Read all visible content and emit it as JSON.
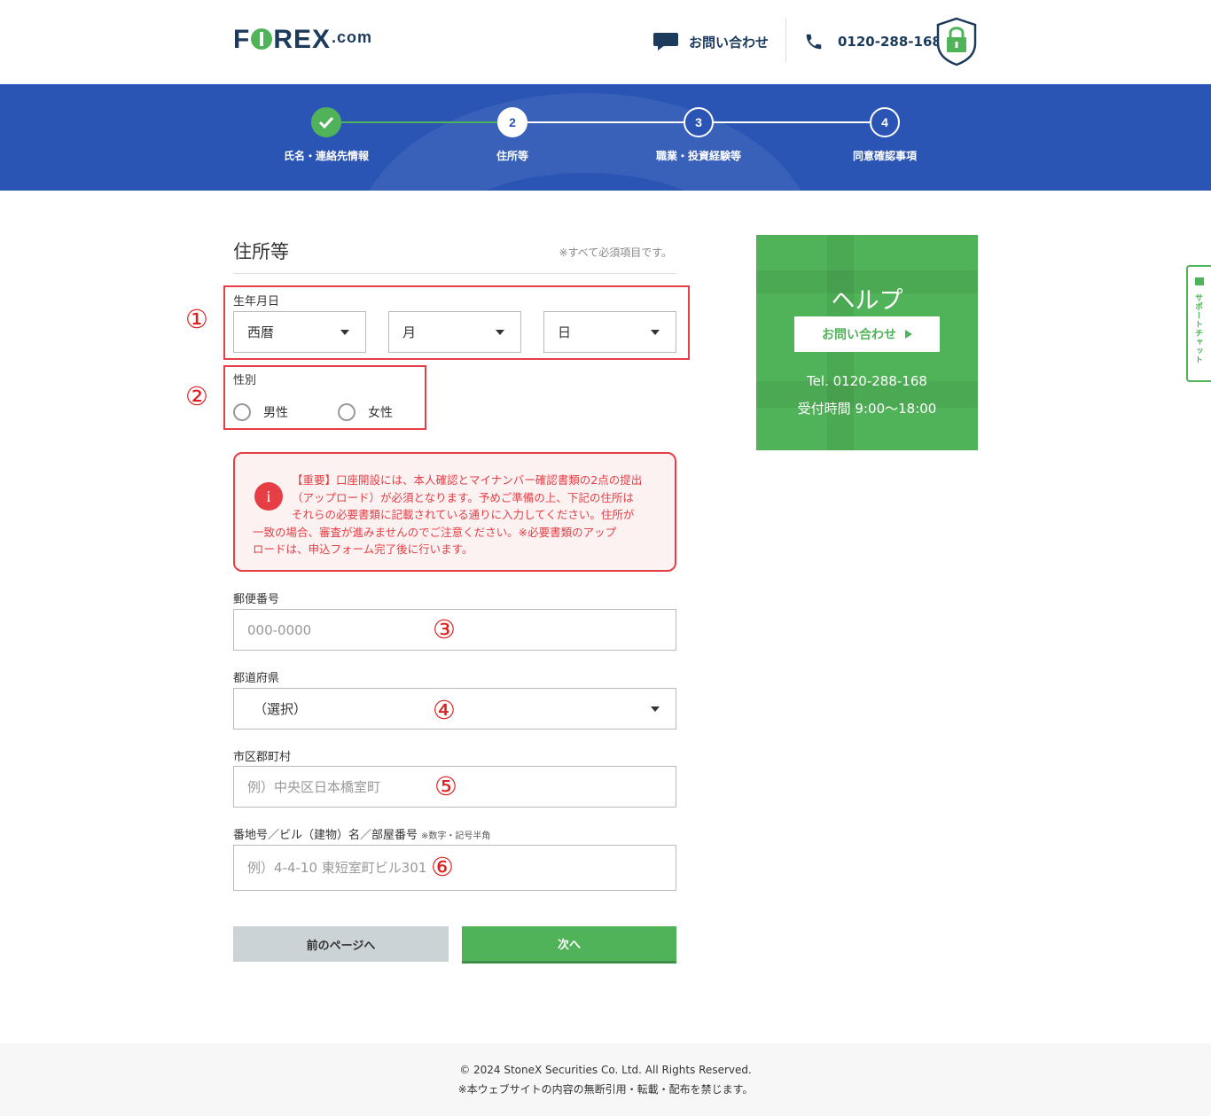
{
  "header": {
    "logo_pre": "F",
    "logo_post": "REX",
    "logo_suffix": ".com",
    "contact_label": "お問い合わせ",
    "phone": "0120-288-168",
    "icons": {
      "contact": "chat-bubble-icon",
      "phone": "phone-icon",
      "security": "shield-lock-icon"
    }
  },
  "steps": [
    {
      "number": "",
      "label": "氏名・連絡先情報",
      "state": "done"
    },
    {
      "number": "2",
      "label": "住所等",
      "state": "current"
    },
    {
      "number": "3",
      "label": "職業・投資経験等",
      "state": "upcoming"
    },
    {
      "number": "4",
      "label": "同意確認事項",
      "state": "upcoming"
    }
  ],
  "form": {
    "title": "住所等",
    "required_note": "※すべて必須項目です。",
    "birthdate": {
      "label": "生年月日",
      "year": "西暦",
      "month": "月",
      "day": "日"
    },
    "gender": {
      "label": "性別",
      "options": [
        "男性",
        "女性"
      ]
    },
    "notice": {
      "lines": [
        "【重要】口座開設には、本人確認とマイナンバー確認書類の2点の提出",
        "（アップロード）が必須となります。予めご準備の上、下記の住所は",
        "それらの必要書類に記載されている通りに入力してください。住所が",
        "一致の場合、審査が進みませんのでご注意ください。※必要書類のアップ",
        "ロードは、申込フォーム完了後に行います。"
      ]
    },
    "postal": {
      "label": "郵便番号",
      "placeholder": "000-0000"
    },
    "prefecture": {
      "label": "都道府県",
      "value": "（選択）"
    },
    "city": {
      "label": "市区郡町村",
      "placeholder": "例）中央区日本橋室町"
    },
    "address": {
      "label": "番地号／ビル（建物）名／部屋番号",
      "note": "※数字・記号半角",
      "placeholder": "例）4-4-10 東短室町ビル301"
    },
    "back_button": "前のページへ",
    "next_button": "次へ"
  },
  "annotations": [
    "①",
    "②",
    "③",
    "④",
    "⑤",
    "⑥"
  ],
  "help": {
    "title": "ヘルプ",
    "button": "お問い合わせ",
    "tel": "Tel. 0120-288-168",
    "hours": "受付時間 9:00～18:00"
  },
  "support_tab": "サポートチャット",
  "footer": {
    "copyright": "© 2024 StoneX Securities Co. Ltd. All Rights Reserved.",
    "note": "※本ウェブサイトの内容の無断引用・転載・配布を禁じます。"
  },
  "colors": {
    "brand_blue": "#2a55b5",
    "brand_green": "#50b359",
    "navy": "#1c3a5c",
    "alert_red": "#e53e45"
  }
}
